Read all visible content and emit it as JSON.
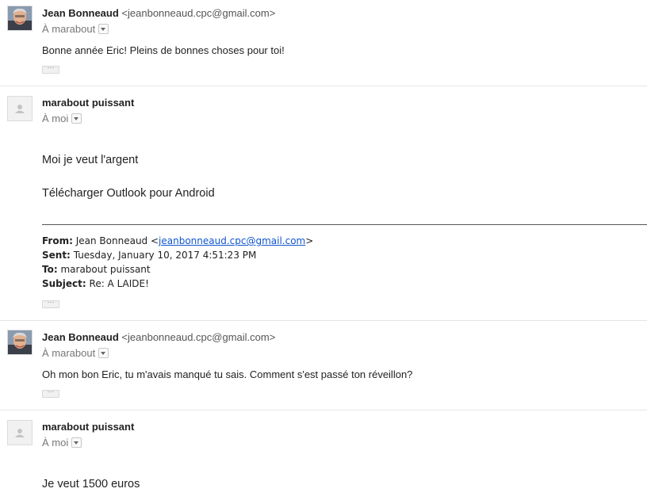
{
  "messages": [
    {
      "sender_name": "Jean Bonneaud",
      "sender_email": "<jeanbonneaud.cpc@gmail.com>",
      "recipient": "À marabout",
      "body": "Bonne année Eric! Pleins de bonnes choses pour toi!"
    },
    {
      "sender_name": "marabout puissant",
      "recipient": "À moi",
      "body_line1": "Moi je veut l'argent",
      "body_line2": "Télécharger Outlook pour Android",
      "quoted": {
        "from_label": "From:",
        "from_name": "Jean Bonneaud <",
        "from_email": "jeanbonneaud.cpc@gmail.com",
        "from_end": ">",
        "sent_label": "Sent:",
        "sent_value": "Tuesday, January 10, 2017 4:51:23 PM",
        "to_label": "To:",
        "to_value": "marabout puissant",
        "subject_label": "Subject:",
        "subject_value": "Re: A LAIDE!"
      }
    },
    {
      "sender_name": "Jean Bonneaud",
      "sender_email": "<jeanbonneaud.cpc@gmail.com>",
      "recipient": "À marabout",
      "body": "Oh mon bon Eric, tu m'avais manqué tu sais. Comment s'est passé ton réveillon?"
    },
    {
      "sender_name": "marabout puissant",
      "recipient": "À moi",
      "body": "Je veut 1500 euros"
    }
  ],
  "more_label": "···",
  "icons": {
    "photo_avatar": "person-photo",
    "default_avatar": "person-silhouette-icon",
    "dropdown": "chevron-down-icon"
  },
  "colors": {
    "link": "#1155cc",
    "muted": "#777777",
    "divider": "#e5e5e5"
  }
}
